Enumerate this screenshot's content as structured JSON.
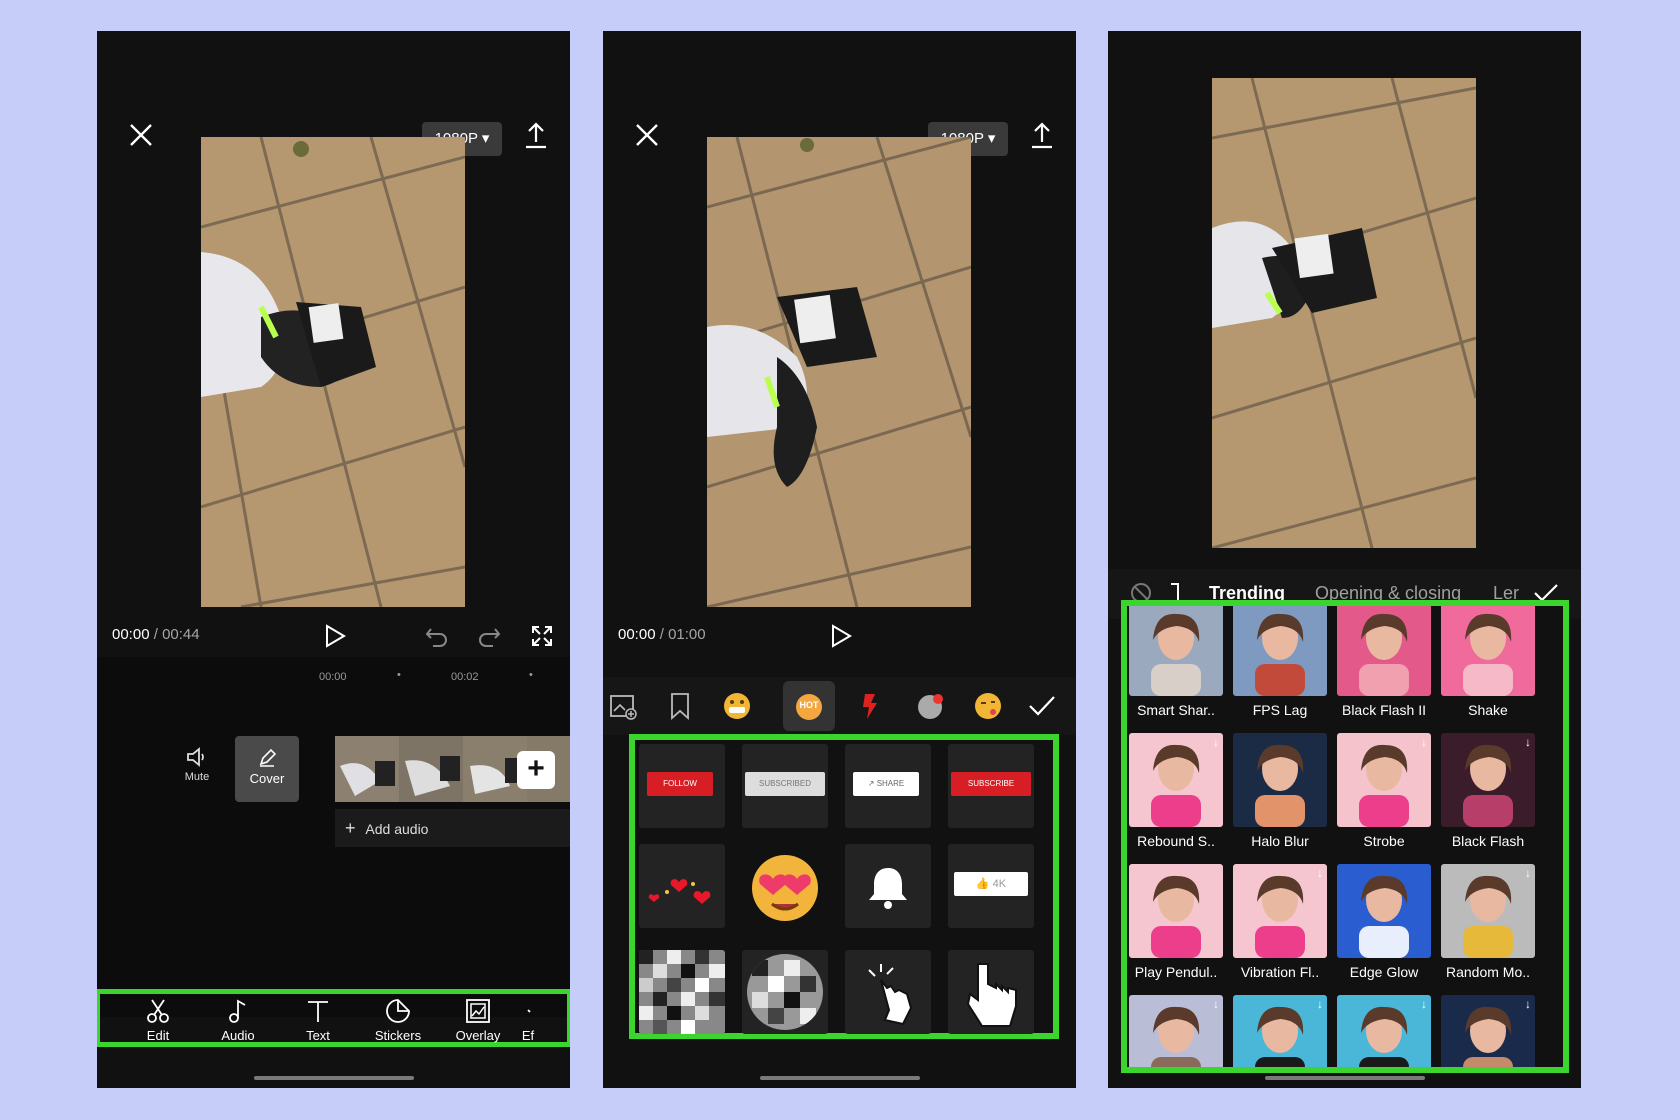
{
  "colors": {
    "highlight": "#3ad52d",
    "background": "#c6cdf9"
  },
  "panel1": {
    "resolution": "1080P",
    "time_current": "00:00",
    "time_sep": " / ",
    "time_total": "00:44",
    "ticks": [
      "00:00",
      "00:02"
    ],
    "mute_label": "Mute",
    "cover_label": "Cover",
    "add_audio": "Add audio",
    "toolbar": [
      "Edit",
      "Audio",
      "Text",
      "Stickers",
      "Overlay",
      "Ef"
    ]
  },
  "panel2": {
    "resolution": "1080P",
    "time_current": "00:00",
    "time_sep": " / ",
    "time_total": "01:00",
    "hot_badge": "HOT",
    "stickers": {
      "follow": "FOLLOW",
      "subscribed": "SUBSCRIBED",
      "share": "SHARE",
      "subscribe": "SUBSCRIBE",
      "likes": "4K"
    }
  },
  "panel3": {
    "tabs": [
      "Trending",
      "Opening & closing",
      "Ler"
    ],
    "effects": [
      {
        "label": "Smart Shar..",
        "download": false
      },
      {
        "label": "FPS Lag",
        "download": false
      },
      {
        "label": "Black Flash II",
        "download": false
      },
      {
        "label": "Shake",
        "download": false
      },
      {
        "label": "Rebound S..",
        "download": true
      },
      {
        "label": "Halo Blur",
        "download": false
      },
      {
        "label": "Strobe",
        "download": true
      },
      {
        "label": "Black Flash",
        "download": true
      },
      {
        "label": "Play Pendul..",
        "download": false
      },
      {
        "label": "Vibration Fl..",
        "download": true
      },
      {
        "label": "Edge Glow",
        "download": false
      },
      {
        "label": "Random Mo..",
        "download": true
      },
      {
        "label": "",
        "download": true
      },
      {
        "label": "",
        "download": true
      },
      {
        "label": "",
        "download": true
      },
      {
        "label": "",
        "download": true
      }
    ]
  }
}
